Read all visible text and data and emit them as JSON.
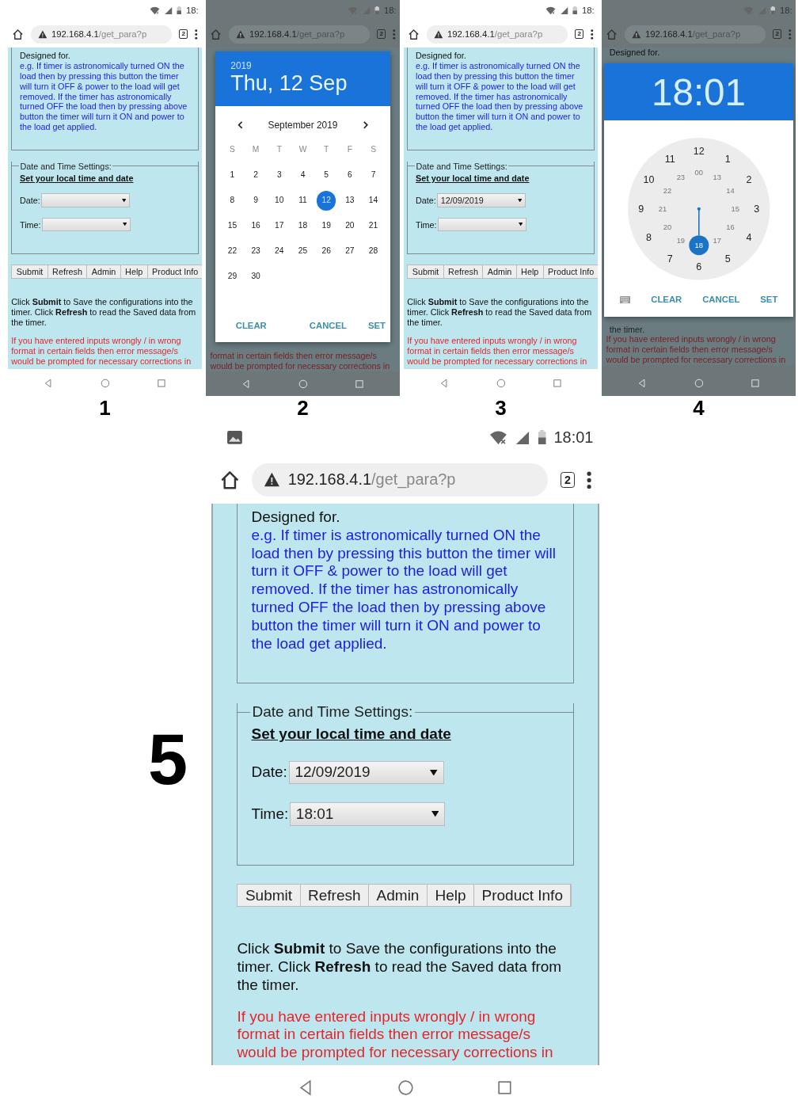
{
  "screens": [
    {
      "kind": "page",
      "step": "1",
      "status": {
        "time": "18:",
        "image_notice": false
      },
      "url": {
        "host": "192.168.4.1",
        "path": "/get_para?p"
      },
      "tab_count": "2",
      "page": {
        "designed": "Designed for.",
        "example": "e.g. If timer is astronomically turned ON the load then by pressing this button the timer will turn it OFF & power to the load will get removed. If the timer has astronomically turned OFF the load then by pressing above button the timer will turn it ON and power to the load get applied.",
        "legend": "Date and Time Settings:",
        "heading": "Set your local time and date",
        "fields": [
          {
            "label": "Date:"
          },
          {
            "label": "Time:"
          }
        ],
        "buttons": [
          "Submit",
          "Refresh",
          "Admin",
          "Help",
          "Product Info"
        ],
        "info": "Click **Submit** to Save the configurations into the timer. Click **Refresh** to read the Saved data from the timer.",
        "error": "If you have entered inputs wrongly / in wrong format in certain fields then error message/s would be prompted for necessary corrections in"
      }
    },
    {
      "kind": "date-dialog",
      "step": "2",
      "status": {
        "time": "18:",
        "image_notice": false
      },
      "url": {
        "host": "192.168.4.1",
        "path": "/get_para?p"
      },
      "tab_count": "2",
      "dialog": {
        "year": "2019",
        "date": "Thu, 12 Sep",
        "month": "September 2019",
        "weekdays": [
          "S",
          "M",
          "T",
          "W",
          "T",
          "F",
          "S"
        ],
        "days": [
          {
            "day": "1",
            "selected": false
          },
          {
            "day": "2",
            "selected": false
          },
          {
            "day": "3",
            "selected": false
          },
          {
            "day": "4",
            "selected": false
          },
          {
            "day": "5",
            "selected": false
          },
          {
            "day": "6",
            "selected": false
          },
          {
            "day": "7",
            "selected": false
          },
          {
            "day": "8",
            "selected": false
          },
          {
            "day": "9",
            "selected": false
          },
          {
            "day": "10",
            "selected": false
          },
          {
            "day": "11",
            "selected": false
          },
          {
            "day": "12",
            "selected": true
          },
          {
            "day": "13",
            "selected": false
          },
          {
            "day": "14",
            "selected": false
          },
          {
            "day": "15",
            "selected": false
          },
          {
            "day": "16",
            "selected": false
          },
          {
            "day": "17",
            "selected": false
          },
          {
            "day": "18",
            "selected": false
          },
          {
            "day": "19",
            "selected": false
          },
          {
            "day": "20",
            "selected": false
          },
          {
            "day": "21",
            "selected": false
          },
          {
            "day": "22",
            "selected": false
          },
          {
            "day": "23",
            "selected": false
          },
          {
            "day": "24",
            "selected": false
          },
          {
            "day": "25",
            "selected": false
          },
          {
            "day": "26",
            "selected": false
          },
          {
            "day": "27",
            "selected": false
          },
          {
            "day": "28",
            "selected": false
          },
          {
            "day": "29",
            "selected": false
          },
          {
            "day": "30",
            "selected": false
          }
        ],
        "actions": [
          "CLEAR",
          "CANCEL",
          "SET"
        ]
      },
      "background": {
        "error": "format in certain fields then error message/s would be prompted for necessary corrections in"
      }
    },
    {
      "kind": "page",
      "step": "3",
      "status": {
        "time": "18:",
        "image_notice": false
      },
      "url": {
        "host": "192.168.4.1",
        "path": "/get_para?p"
      },
      "tab_count": "2",
      "page": {
        "designed": "Designed for.",
        "example": "e.g. If timer is astronomically turned ON the load then by pressing this button the timer will turn it OFF & power to the load will get removed. If the timer has astronomically turned OFF the load then by pressing above button the timer will turn it ON and power to the load get applied.",
        "legend": "Date and Time Settings:",
        "heading": "Set your local time and date",
        "fields": [
          {
            "label": "Date:",
            "value": "12/09/2019"
          },
          {
            "label": "Time:"
          }
        ],
        "buttons": [
          "Submit",
          "Refresh",
          "Admin",
          "Help",
          "Product Info"
        ],
        "info": "Click **Submit** to Save the configurations into the timer. Click **Refresh** to read the Saved data from the timer.",
        "error": "If you have entered inputs wrongly / in wrong format in certain fields then error message/s would be prompted for necessary corrections in"
      }
    },
    {
      "kind": "time-dialog",
      "step": "4",
      "status": {
        "time": "18:",
        "image_notice": false
      },
      "url": {
        "host": "192.168.4.1",
        "path": "/get_para?p"
      },
      "tab_count": "2",
      "dialog": {
        "time": "18:01",
        "outer_hours": [
          "12",
          "1",
          "2",
          "3",
          "4",
          "5",
          "6",
          "7",
          "8",
          "9",
          "10",
          "11"
        ],
        "inner_hours": [
          {
            "label": "00",
            "selected": false
          },
          {
            "label": "13",
            "selected": false
          },
          {
            "label": "14",
            "selected": false
          },
          {
            "label": "15",
            "selected": false
          },
          {
            "label": "16",
            "selected": false
          },
          {
            "label": "17",
            "selected": false
          },
          {
            "label": "18",
            "selected": true
          },
          {
            "label": "19",
            "selected": false
          },
          {
            "label": "20",
            "selected": false
          },
          {
            "label": "21",
            "selected": false
          },
          {
            "label": "22",
            "selected": false
          },
          {
            "label": "23",
            "selected": false
          }
        ],
        "actions": [
          "CLEAR",
          "CANCEL",
          "SET"
        ]
      },
      "background": {
        "top": "Designed for.",
        "bottom": "the timer.",
        "error": "If you have entered inputs wrongly / in wrong format in certain fields then error message/s would be prompted for necessary corrections in"
      }
    },
    {
      "kind": "page",
      "step": "5",
      "status": {
        "time": "18:01",
        "image_notice": true
      },
      "url": {
        "host": "192.168.4.1",
        "path": "/get_para?p"
      },
      "tab_count": "2",
      "page": {
        "designed": "Designed for.",
        "example": "e.g. If timer is astronomically turned ON the load then by pressing this button the timer will turn it OFF & power to the load will get removed. If the timer has astronomically turned OFF the load then by pressing above button the timer will turn it ON and power to the load get applied.",
        "legend": "Date and Time Settings:",
        "heading": "Set your local time and date",
        "fields": [
          {
            "label": "Date:",
            "value": "12/09/2019"
          },
          {
            "label": "Time:",
            "value": "18:01"
          }
        ],
        "buttons": [
          "Submit",
          "Refresh",
          "Admin",
          "Help",
          "Product Info"
        ],
        "info": "Click **Submit** to Save the configurations into the timer. Click **Refresh** to read the Saved data from the timer.",
        "error": "If you have entered inputs wrongly / in wrong format in certain fields then error message/s would be prompted for necessary corrections in"
      }
    }
  ]
}
